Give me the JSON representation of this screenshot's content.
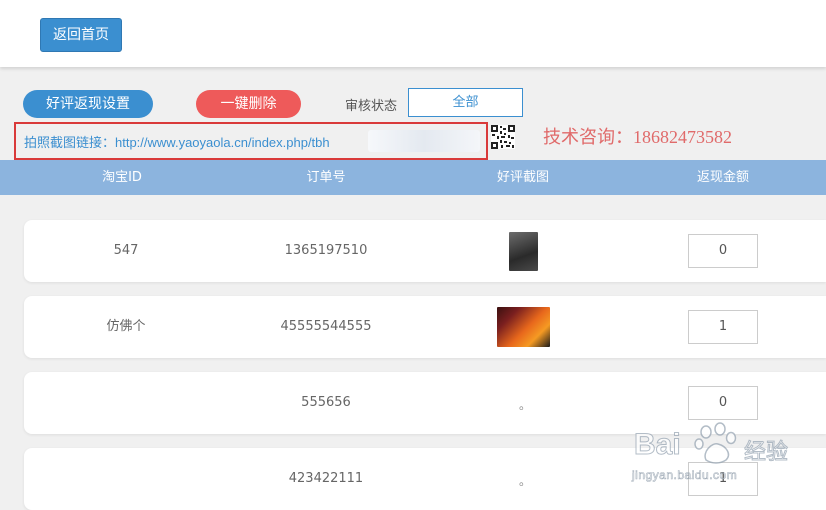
{
  "header": {
    "home_button": "返回首页"
  },
  "controls": {
    "settings_button": "好评返现设置",
    "delete_button": "一键删除",
    "status_label": "审核状态",
    "status_value": "全部",
    "link_text": "拍照截图链接：http://www.yaoyaola.cn/index.php/tbh",
    "contact": "技术咨询：18682473582"
  },
  "table": {
    "headers": [
      "淘宝ID",
      "订单号",
      "好评截图",
      "返现金额"
    ],
    "rows": [
      {
        "taobao_id": "547",
        "order_no": "1365197510",
        "screenshot": "image",
        "amount": "0"
      },
      {
        "taobao_id": "仿佛个",
        "order_no": "45555544555",
        "screenshot": "image",
        "amount": "1"
      },
      {
        "taobao_id": "",
        "order_no": "555656",
        "screenshot": "。",
        "amount": "0"
      },
      {
        "taobao_id": "",
        "order_no": "423422111",
        "screenshot": "。",
        "amount": "1"
      }
    ]
  },
  "watermark": {
    "brand": "Bai",
    "suffix": "经验",
    "url": "jingyan.baidu.com"
  },
  "colors": {
    "accent": "#3b8fd0",
    "danger": "#ee5a5a",
    "header_bg": "#8cb4de",
    "highlight_border": "#d93a3a"
  }
}
